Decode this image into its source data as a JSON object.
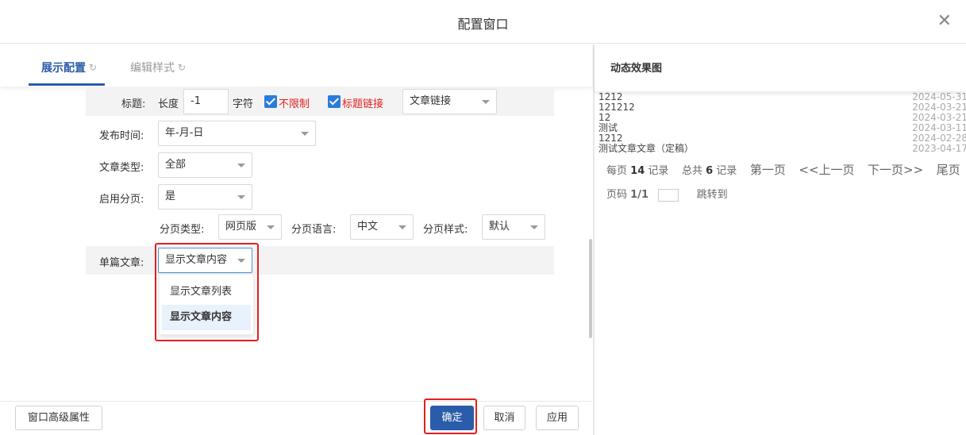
{
  "window": {
    "title": "配置窗口"
  },
  "tabs": [
    {
      "label": "展示配置",
      "active": true
    },
    {
      "label": "编辑样式",
      "active": false
    }
  ],
  "form": {
    "title_row": {
      "label": "标题:",
      "length_label": "长度",
      "length_value": "-1",
      "unit_label": "字符",
      "unlimited_label": "不限制",
      "title_link_label": "标题链接",
      "link_select": "文章链接"
    },
    "publish_time": {
      "label": "发布时间:",
      "value": "年-月-日"
    },
    "article_type": {
      "label": "文章类型:",
      "value": "全部"
    },
    "pagination": {
      "label": "启用分页:",
      "value": "是"
    },
    "page_options": {
      "type_label": "分页类型:",
      "type_value": "网页版",
      "lang_label": "分页语言:",
      "lang_value": "中文",
      "style_label": "分页样式:",
      "style_value": "默认"
    },
    "single_article": {
      "label": "单篇文章:",
      "value": "显示文章内容",
      "options": [
        "显示文章列表",
        "显示文章内容"
      ]
    }
  },
  "footer": {
    "advanced": "窗口高级属性",
    "confirm": "确定",
    "cancel": "取消",
    "apply": "应用"
  },
  "preview": {
    "title": "动态效果图",
    "items": [
      {
        "title": "1212",
        "date": "2024-05-31"
      },
      {
        "title": "121212",
        "date": "2024-03-21"
      },
      {
        "title": "12",
        "date": "2024-03-21"
      },
      {
        "title": "测试",
        "date": "2024-03-11"
      },
      {
        "title": "1212",
        "date": "2024-02-28"
      },
      {
        "title": "测试文章文章（定稿）",
        "date": "2023-04-17"
      }
    ],
    "pager": {
      "per_page_prefix": "每页",
      "per_page": "14",
      "per_page_suffix": "记录",
      "total_prefix": "总共",
      "total": "6",
      "total_suffix": "记录",
      "first": "第一页",
      "prev": "<<上一页",
      "next": "下一页>>",
      "last": "尾页",
      "page_label": "页码",
      "page_value": "1/1",
      "jump": "跳转到"
    }
  },
  "colors": {
    "accent": "#2a5caa",
    "highlight": "#e02020",
    "checkbox": "#2a7bde"
  }
}
